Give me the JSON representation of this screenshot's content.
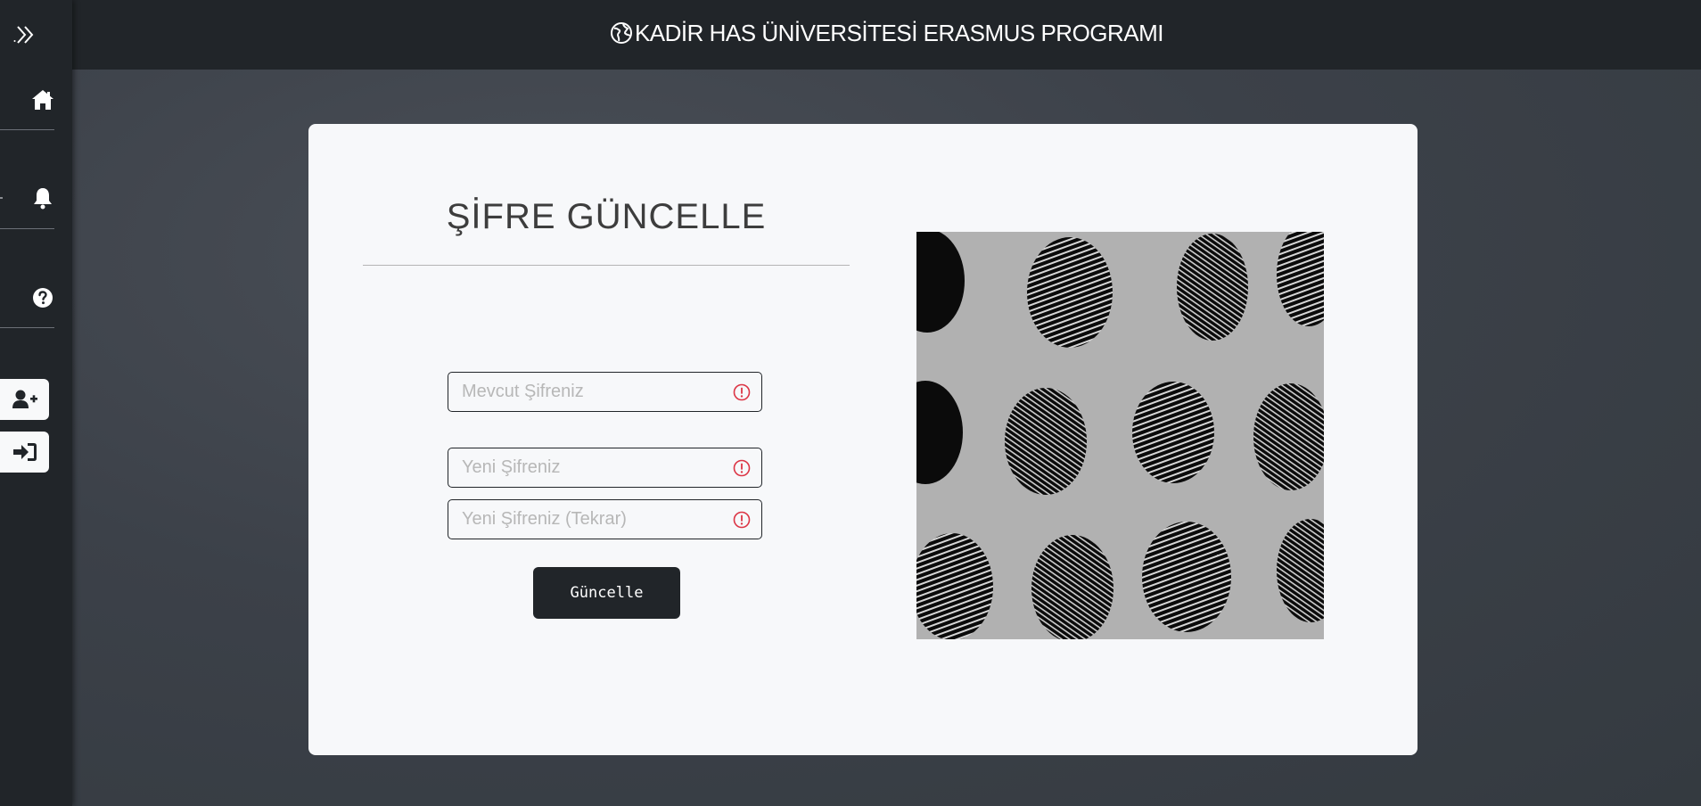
{
  "header": {
    "title": "KADİR HAS ÜNİVERSİTESİ ERASMUS PROGRAMI",
    "icon": "globe-icon"
  },
  "sidebar": {
    "toggle_icon": "double-chevron-right-icon",
    "items": [
      {
        "name": "home",
        "icon": "home-icon"
      },
      {
        "name": "notifications",
        "icon": "bell-icon"
      },
      {
        "name": "help",
        "icon": "question-circle-icon"
      }
    ],
    "buttons": [
      {
        "name": "register",
        "icon": "user-plus-icon"
      },
      {
        "name": "login",
        "icon": "sign-in-icon"
      }
    ]
  },
  "form": {
    "title": "ŞİFRE GÜNCELLE",
    "current_password_placeholder": "Mevcut Şifreniz",
    "new_password_placeholder": "Yeni Şifreniz",
    "new_password_repeat_placeholder": "Yeni Şifreniz (Tekrar)",
    "submit_label": "Güncelle"
  },
  "colors": {
    "sidebar_bg": "#212529",
    "card_bg": "#f7f8fa",
    "warning": "#dc3545",
    "button_bg": "#212529"
  }
}
